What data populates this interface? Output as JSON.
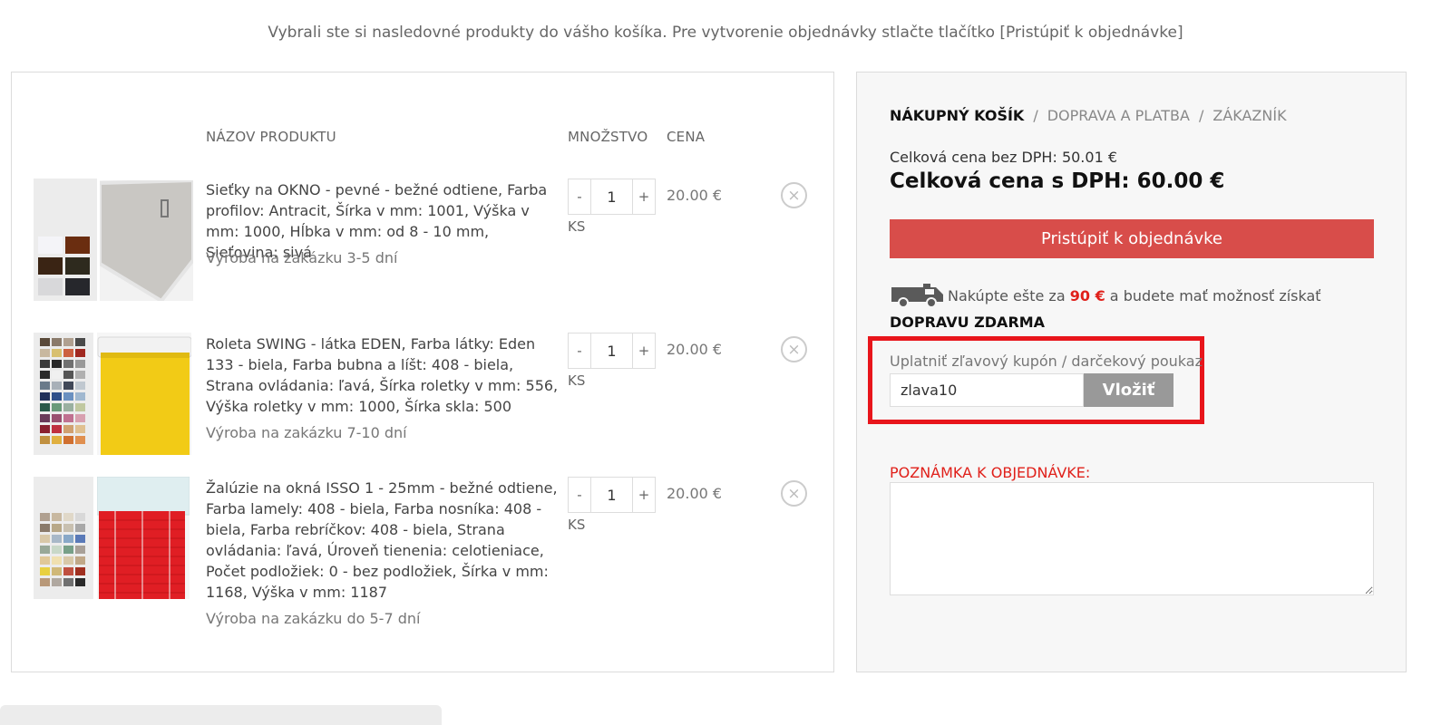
{
  "intro": "Vybrali ste si nasledovné produkty do vášho košíka. Pre vytvorenie objednávky stlačte tlačítko [Pristúpiť k objednávke]",
  "cart": {
    "headers": {
      "name": "NÁZOV PRODUKTU",
      "qty": "MNOŽSTVO",
      "price": "CENA"
    },
    "items": [
      {
        "name": "Sieťky na OKNO - pevné - bežné odtiene, Farba profilov: Antracit, Šírka v mm: 1001, Výška v mm: 1000, Hĺbka v mm: od 8 - 10 mm, Sieťovina: sivá",
        "note": "Výroba na zakázku 3-5 dní",
        "qty": "1",
        "unit": "KS",
        "price": "20.00 €"
      },
      {
        "name": "Roleta SWING - látka EDEN, Farba látky: Eden 133 - biela, Farba bubna a líšt: 408 - biela, Strana ovládania: ľavá, Šírka roletky v mm: 556, Výška roletky v mm: 1000, Šírka skla: 500",
        "note": "Výroba na zakázku 7-10 dní",
        "qty": "1",
        "unit": "KS",
        "price": "20.00 €"
      },
      {
        "name": "Žalúzie na okná ISSO 1 - 25mm - bežné odtiene, Farba lamely: 408 - biela, Farba nosníka: 408 - biela, Farba rebríčkov: 408 - biela, Strana ovládania: ľavá, Úroveň tienenia: celotieniace, Počet podložiek: 0 - bez podložiek, Šírka v mm: 1168, Výška v mm: 1187",
        "note": "Výroba na zakázku do 5-7 dní",
        "qty": "1",
        "unit": "KS",
        "price": "20.00 €"
      }
    ],
    "qty_minus": "-",
    "qty_plus": "+",
    "remove_icon": "×"
  },
  "summary": {
    "steps": [
      "NÁKUPNÝ KOŠÍK",
      "DOPRAVA A PLATBA",
      "ZÁKAZNÍK"
    ],
    "step_sep": "/",
    "price_no_vat": "Celková cena bez DPH: 50.01 €",
    "price_vat": "Celková cena s DPH: 60.00 €",
    "proceed_label": "Pristúpiť k objednávke",
    "shipping": {
      "pre": "Nakúpte ešte za",
      "amount": "90 €",
      "mid": "a budete mať možnosť získať",
      "free": "DOPRAVU ZDARMA"
    },
    "coupon": {
      "label": "Uplatniť zľavový kupón / darčekový poukaz",
      "value": "zlava10",
      "button": "Vložiť"
    },
    "note_label": "POZNÁMKA K OBJEDNÁVKE:",
    "note_value": ""
  },
  "colors": {
    "accent": "#d84d4a",
    "highlight": "#e8151b",
    "price_red": "#e0201a"
  }
}
